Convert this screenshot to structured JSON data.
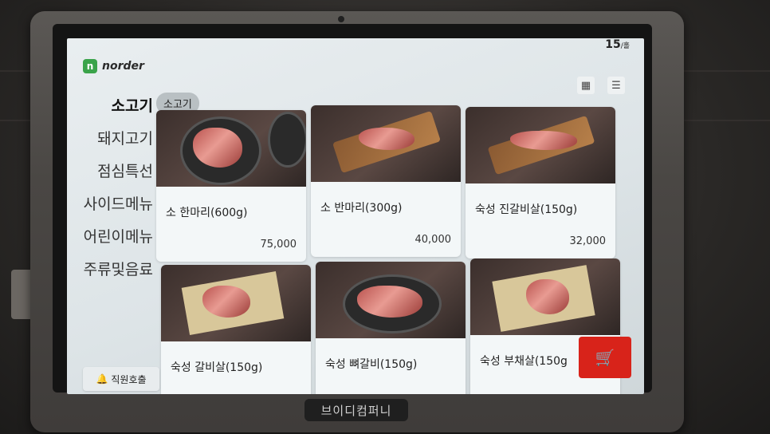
{
  "header": {
    "logo_mark": "n",
    "logo_text": "norder",
    "table_number": "15",
    "table_suffix": "/홀"
  },
  "icons": {
    "grid": "grid-view-icon",
    "menu": "hamburger-menu-icon",
    "cart": "cart-icon",
    "bell": "bell-icon"
  },
  "sidebar": {
    "items": [
      {
        "label": "소고기",
        "active": true
      },
      {
        "label": "돼지고기"
      },
      {
        "label": "점심특선"
      },
      {
        "label": "사이드메뉴"
      },
      {
        "label": "어린이메뉴"
      },
      {
        "label": "주류및음료"
      }
    ]
  },
  "category_chip": "소고기",
  "products": [
    {
      "name": "소 한마리(600g)",
      "price": "75,000"
    },
    {
      "name": "소 반마리(300g)",
      "price": "40,000"
    },
    {
      "name": "숙성 진갈비살(150g)",
      "price": "32,000"
    },
    {
      "name": "숙성 갈비살(150g)",
      "price": ""
    },
    {
      "name": "숙성 뼈갈비(150g)",
      "price": ""
    },
    {
      "name": "숙성 부채살(150g",
      "price": ""
    }
  ],
  "staff_call": "직원호출",
  "device_brand": "브이디컴퍼니",
  "colors": {
    "accent": "#d8231a",
    "logo_green": "#3aa34a"
  }
}
